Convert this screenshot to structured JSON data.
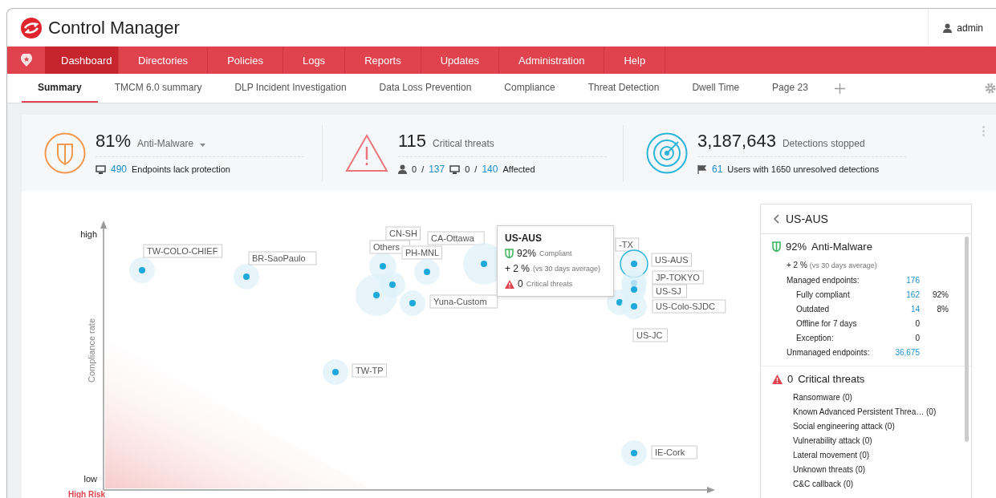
{
  "app": {
    "title": "Control Manager",
    "user": "admin"
  },
  "nav": [
    {
      "label": "Dashboard",
      "selected": true
    },
    {
      "label": "Directories",
      "selected": false
    },
    {
      "label": "Policies",
      "selected": false
    },
    {
      "label": "Logs",
      "selected": false
    },
    {
      "label": "Reports",
      "selected": false
    },
    {
      "label": "Updates",
      "selected": false
    },
    {
      "label": "Administration",
      "selected": false
    },
    {
      "label": "Help",
      "selected": false
    }
  ],
  "tabs": [
    {
      "label": "Summary",
      "selected": true
    },
    {
      "label": "TMCM 6.0 summary",
      "selected": false
    },
    {
      "label": "DLP Incident Investigation",
      "selected": false
    },
    {
      "label": "Data Loss Prevention",
      "selected": false
    },
    {
      "label": "Compliance",
      "selected": false
    },
    {
      "label": "Threat Detection",
      "selected": false
    },
    {
      "label": "Dwell Time",
      "selected": false
    },
    {
      "label": "Page 23",
      "selected": false
    }
  ],
  "summary": [
    {
      "kind": "malware",
      "value": "81%",
      "label": "Anti-Malware",
      "line": [
        {
          "kind": "monitor"
        },
        {
          "kind": "link",
          "text": "490"
        },
        {
          "kind": "text",
          "text": "Endpoints lack protection"
        }
      ]
    },
    {
      "kind": "threats",
      "value": "115",
      "label": "Critical threats",
      "line": [
        {
          "kind": "user"
        },
        {
          "kind": "text",
          "text": "0"
        },
        {
          "kind": "sep",
          "text": "/"
        },
        {
          "kind": "link",
          "text": "137"
        },
        {
          "kind": "monitor"
        },
        {
          "kind": "text",
          "text": "0"
        },
        {
          "kind": "sep",
          "text": "/"
        },
        {
          "kind": "link",
          "text": "140"
        },
        {
          "kind": "text",
          "text": "Affected"
        }
      ]
    },
    {
      "kind": "detections",
      "value": "3,187,643",
      "label": "Detections stopped",
      "line": [
        {
          "kind": "flag"
        },
        {
          "kind": "link",
          "text": "61"
        },
        {
          "kind": "text",
          "text": "Users with 1650 unresolved detections"
        }
      ]
    }
  ],
  "chart": {
    "y_high": "high",
    "y_low": "low",
    "y_title": "Compliance rate",
    "corner": "High Risk",
    "bubbles": [
      {
        "label": "TW-COLO-CHIEF",
        "selected": false
      },
      {
        "label": "BR-SaoPaulo",
        "selected": false
      },
      {
        "label": "CN-SH",
        "selected": false
      },
      {
        "label": "Others",
        "selected": false
      },
      {
        "label": "PH-MNL",
        "selected": false
      },
      {
        "label": "CA-Ottawa",
        "selected": false
      },
      {
        "label": "Yuna-Custom",
        "selected": false
      },
      {
        "label": "-TX",
        "selected": false
      },
      {
        "label": "US-AUS",
        "selected": true
      },
      {
        "label": "JP-TOKYO",
        "selected": false
      },
      {
        "label": "US-SJ",
        "selected": false
      },
      {
        "label": "US-JC",
        "selected": false
      },
      {
        "label": "US-Colo-SJDC",
        "selected": false
      },
      {
        "label": "TW-TP",
        "selected": false
      },
      {
        "label": "IE-Cork",
        "selected": false
      }
    ],
    "tooltip": {
      "title": "US-AUS",
      "compliance": "92%",
      "compliance_label": "Compliant",
      "change": "+ 2 %",
      "change_note": "(vs 30 days average)",
      "threats": "0",
      "threats_label": "Critical threats"
    }
  },
  "panel": {
    "title": "US-AUS",
    "malware": {
      "value": "92%",
      "label": "Anti-Malware",
      "change": "+ 2 %",
      "change_note": "(vs 30 days average)",
      "rows": [
        {
          "label": "Managed endpoints:",
          "count": "176",
          "linked": true,
          "children": [
            {
              "label": "Fully compliant",
              "count": "162",
              "linked": true,
              "percent": "92%"
            },
            {
              "label": "Outdated",
              "count": "14",
              "linked": true,
              "percent": "8%"
            },
            {
              "label": "Offline for 7 days",
              "count": "0",
              "linked": false
            },
            {
              "label": "Exception:",
              "count": "0",
              "linked": false
            }
          ]
        },
        {
          "label": "Unmanaged endpoints:",
          "count": "36,675",
          "linked": true
        }
      ]
    },
    "threats": {
      "count": "0",
      "label": "Critical threats",
      "items": [
        "Ransomware (0)",
        "Known Advanced Persistent Threa… (0)",
        "Social engineering attack (0)",
        "Vulnerability attack (0)",
        "Lateral movement (0)",
        "Unknown threats (0)",
        "C&C callback (0)"
      ]
    }
  }
}
